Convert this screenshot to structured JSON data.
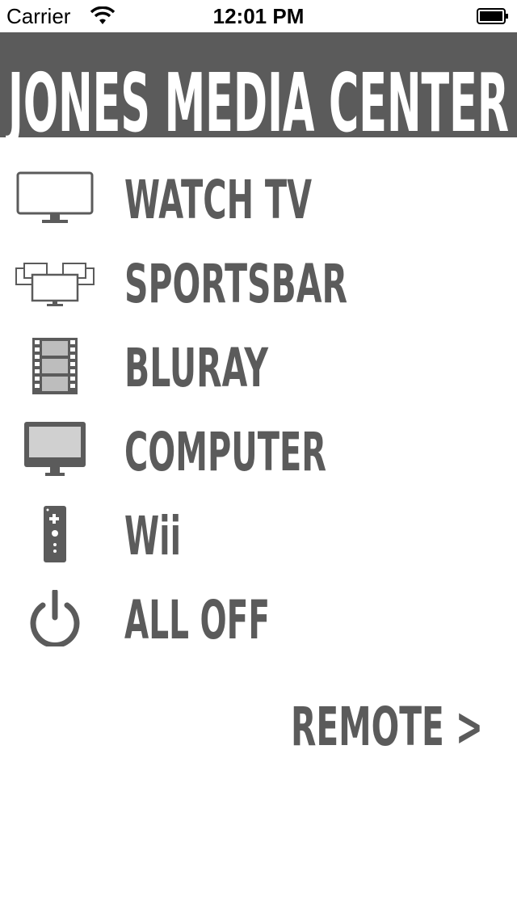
{
  "status_bar": {
    "carrier": "Carrier",
    "time": "12:01 PM",
    "wifi_icon": "wifi-icon",
    "battery_icon": "battery-full-icon"
  },
  "header": {
    "title": "JONES MEDIA CENTER",
    "background_color": "#5b5b5b",
    "text_color": "#ffffff"
  },
  "menu": {
    "items": [
      {
        "label": "WATCH TV",
        "icon": "tv-icon"
      },
      {
        "label": "SPORTSBAR",
        "icon": "multi-screen-icon"
      },
      {
        "label": "BLURAY",
        "icon": "film-strip-icon"
      },
      {
        "label": "COMPUTER",
        "icon": "monitor-icon"
      },
      {
        "label": "Wii",
        "icon": "wii-remote-icon"
      },
      {
        "label": "ALL OFF",
        "icon": "power-icon"
      }
    ],
    "text_color": "#5b5b5b"
  },
  "remote_link": {
    "label": "REMOTE >"
  }
}
